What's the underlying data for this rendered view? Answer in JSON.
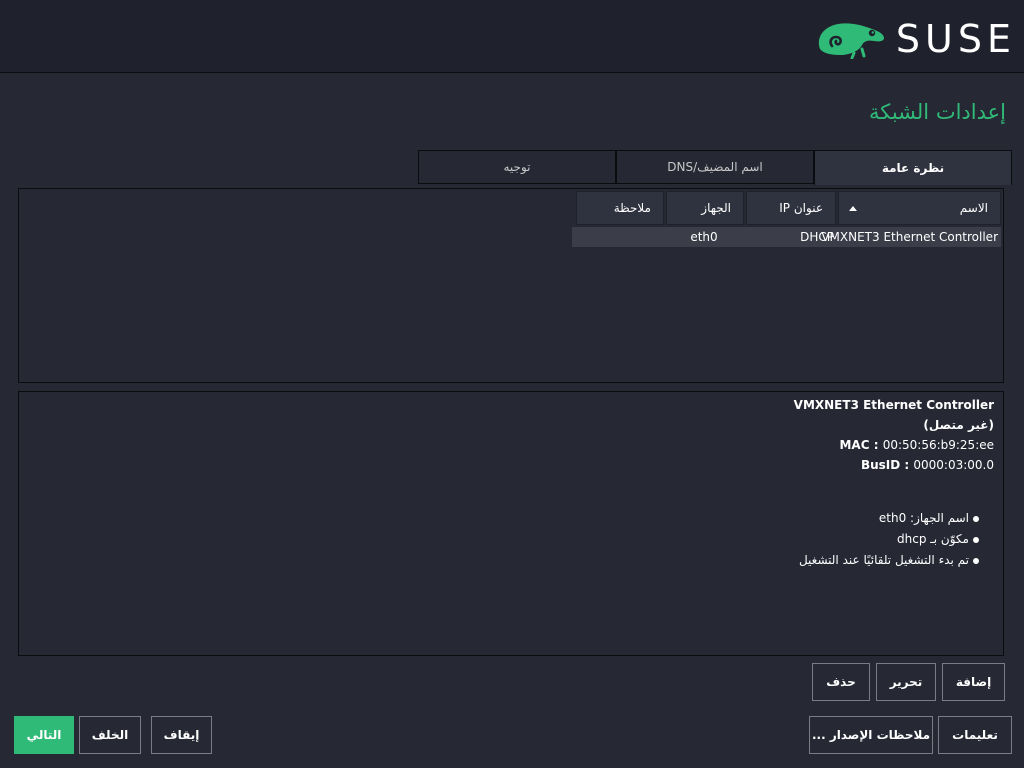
{
  "brand": {
    "name": "SUSE",
    "accent": "#30ba78"
  },
  "page": {
    "title": "إعدادات الشبكة"
  },
  "tabs": [
    {
      "label": "نظرة عامة",
      "active": true
    },
    {
      "label": "اسم المضيف/DNS",
      "active": false
    },
    {
      "label": "توجيه",
      "active": false
    }
  ],
  "table": {
    "headers": {
      "name": "الاسم",
      "ip": "عنوان IP",
      "device": "الجهاز",
      "note": "ملاحظة"
    },
    "rows": [
      {
        "name": "VMXNET3 Ethernet Controller",
        "ip": "DHCP",
        "device": "eth0",
        "note": ""
      }
    ]
  },
  "details": {
    "title": "VMXNET3 Ethernet Controller",
    "status": "(غير متصل)",
    "mac_label": "MAC",
    "mac_value": "00:50:56:b9:25:ee",
    "busid_label": "BusID",
    "busid_value": "0000:03:00.0",
    "bullets": [
      "اسم الجهاز: eth0",
      "مكوّن بـ dhcp",
      "تم بدء التشغيل تلقائيًا عند التشغيل"
    ]
  },
  "actions": {
    "add": "إضافة",
    "edit": "تحرير",
    "delete": "حذف"
  },
  "footer": {
    "help": "تعليمات",
    "release_notes": "ملاحظات الإصدار ...",
    "abort": "إيقاف",
    "back": "الخلف",
    "next": "التالي"
  },
  "icons": {
    "logo": "suse-chameleon-icon",
    "sort": "sort-ascending-icon"
  }
}
